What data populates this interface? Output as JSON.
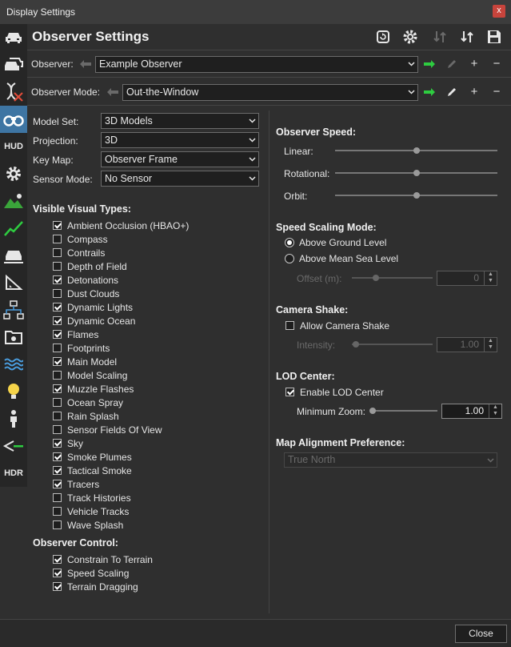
{
  "window": {
    "title": "Display Settings",
    "close_glyph": "x"
  },
  "header": {
    "title": "Observer Settings"
  },
  "sidebar": {
    "items": [
      {
        "icon": "car-front-icon"
      },
      {
        "icon": "car-multiple-icon"
      },
      {
        "icon": "dna-icon"
      },
      {
        "icon": "binoculars-icon",
        "active": true
      },
      {
        "icon": "hud-icon",
        "text": "HUD"
      },
      {
        "icon": "gear-icon"
      },
      {
        "icon": "landscape-icon"
      },
      {
        "icon": "line-graph-icon"
      },
      {
        "icon": "car-road-icon"
      },
      {
        "icon": "measure-icon"
      },
      {
        "icon": "network-icon"
      },
      {
        "icon": "folder-gear-icon"
      },
      {
        "icon": "waves-icon"
      },
      {
        "icon": "lightbulb-icon"
      },
      {
        "icon": "person-icon"
      },
      {
        "icon": "sensor-icon"
      },
      {
        "icon": "hdr-icon",
        "text": "HDR"
      }
    ]
  },
  "observer_row": {
    "label": "Observer:",
    "value": "Example Observer"
  },
  "mode_row": {
    "label": "Observer Mode:",
    "value": "Out-the-Window"
  },
  "left": {
    "model_set": {
      "label": "Model Set:",
      "value": "3D Models"
    },
    "projection": {
      "label": "Projection:",
      "value": "3D"
    },
    "key_map": {
      "label": "Key Map:",
      "value": "Observer Frame"
    },
    "sensor_mode": {
      "label": "Sensor Mode:",
      "value": "No Sensor"
    },
    "visible_title": "Visible Visual Types:",
    "visible_types": [
      {
        "label": "Ambient Occlusion (HBAO+)",
        "checked": true
      },
      {
        "label": "Compass",
        "checked": false
      },
      {
        "label": "Contrails",
        "checked": false
      },
      {
        "label": "Depth of Field",
        "checked": false
      },
      {
        "label": "Detonations",
        "checked": true
      },
      {
        "label": "Dust Clouds",
        "checked": false
      },
      {
        "label": "Dynamic Lights",
        "checked": true
      },
      {
        "label": "Dynamic Ocean",
        "checked": true
      },
      {
        "label": "Flames",
        "checked": true
      },
      {
        "label": "Footprints",
        "checked": false
      },
      {
        "label": "Main Model",
        "checked": true
      },
      {
        "label": "Model Scaling",
        "checked": false
      },
      {
        "label": "Muzzle Flashes",
        "checked": true
      },
      {
        "label": "Ocean Spray",
        "checked": false
      },
      {
        "label": "Rain Splash",
        "checked": false
      },
      {
        "label": "Sensor Fields Of View",
        "checked": false
      },
      {
        "label": "Sky",
        "checked": true
      },
      {
        "label": "Smoke Plumes",
        "checked": true
      },
      {
        "label": "Tactical Smoke",
        "checked": true
      },
      {
        "label": "Tracers",
        "checked": true
      },
      {
        "label": "Track Histories",
        "checked": false
      },
      {
        "label": "Vehicle Tracks",
        "checked": false
      },
      {
        "label": "Wave Splash",
        "checked": false
      }
    ],
    "control_title": "Observer Control:",
    "control_items": [
      {
        "label": "Constrain To Terrain",
        "checked": true
      },
      {
        "label": "Speed Scaling",
        "checked": true
      },
      {
        "label": "Terrain Dragging",
        "checked": true
      }
    ]
  },
  "right": {
    "speed_title": "Observer Speed:",
    "speeds": [
      {
        "label": "Linear:",
        "level": 0.5
      },
      {
        "label": "Rotational:",
        "level": 0.5
      },
      {
        "label": "Orbit:",
        "level": 0.5
      }
    ],
    "scaling_title": "Speed Scaling Mode:",
    "scaling_options": [
      {
        "label": "Above Ground Level",
        "selected": true
      },
      {
        "label": "Above Mean Sea Level",
        "selected": false
      }
    ],
    "offset": {
      "label": "Offset (m):",
      "value": "0",
      "level": 0.3
    },
    "shake_title": "Camera Shake:",
    "shake_checkbox": {
      "label": "Allow Camera Shake",
      "checked": false
    },
    "intensity": {
      "label": "Intensity:",
      "value": "1.00",
      "level": 0.05
    },
    "lod_title": "LOD Center:",
    "lod_checkbox": {
      "label": "Enable LOD Center",
      "checked": true
    },
    "min_zoom": {
      "label": "Minimum Zoom:",
      "value": "1.00",
      "level": 0.0
    },
    "map_title": "Map Alignment Preference:",
    "map_value": "True North"
  },
  "footer": {
    "close_label": "Close"
  },
  "colors": {
    "accent": "#3e75a3",
    "arrow_green": "#2ecc40",
    "close_red": "#c8443c"
  }
}
